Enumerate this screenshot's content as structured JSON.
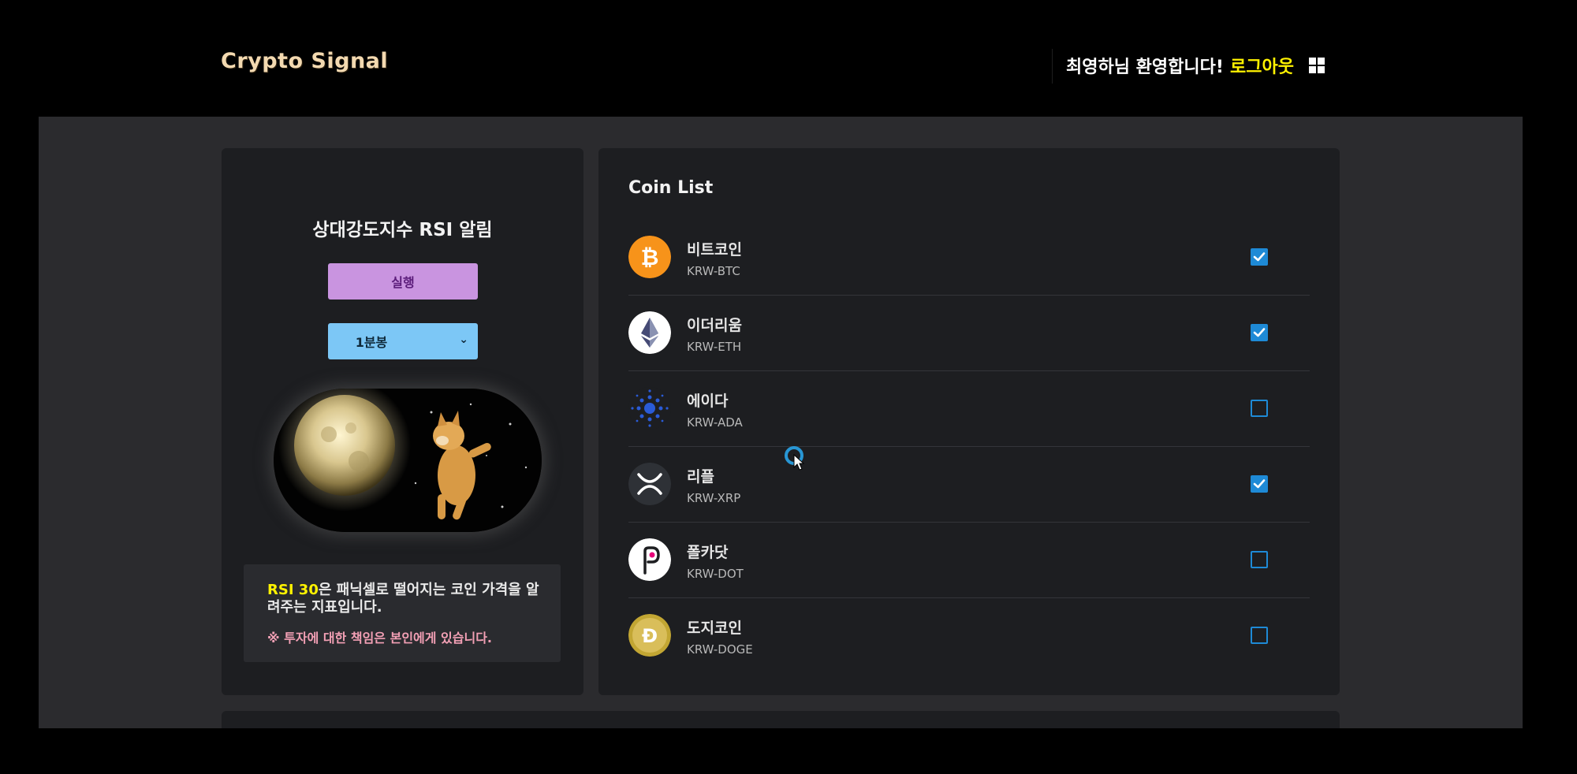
{
  "header": {
    "brand": "Crypto Signal",
    "welcome": "최영하님 환영합니다!",
    "logout": "로그아웃",
    "menu_icon": "grid-icon"
  },
  "left_panel": {
    "title": "상대강도지수 RSI 알림",
    "run_button": "실행",
    "interval_select": {
      "value": "1분봉"
    },
    "info": {
      "highlight": "RSI 30",
      "text": "은 패닉셀로 떨어지는 코인 가격을 알려주는 지표입니다.",
      "warning": "※ 투자에 대한 책임은 본인에게 있습니다."
    }
  },
  "coin_list": {
    "title": "Coin List",
    "items": [
      {
        "name": "비트코인",
        "code": "KRW-BTC",
        "checked": true,
        "icon": "bitcoin-icon"
      },
      {
        "name": "이더리움",
        "code": "KRW-ETH",
        "checked": true,
        "icon": "ethereum-icon"
      },
      {
        "name": "에이다",
        "code": "KRW-ADA",
        "checked": false,
        "icon": "cardano-icon"
      },
      {
        "name": "리플",
        "code": "KRW-XRP",
        "checked": true,
        "icon": "xrp-icon"
      },
      {
        "name": "폴카닷",
        "code": "KRW-DOT",
        "checked": false,
        "icon": "polkadot-icon"
      },
      {
        "name": "도지코인",
        "code": "KRW-DOGE",
        "checked": false,
        "icon": "dogecoin-icon"
      }
    ]
  },
  "colors": {
    "accent_yellow": "#fff200",
    "run_button": "#c994e0",
    "select_bg": "#7cc7f6",
    "checkbox": "#1e8ad6",
    "warning_pink": "#f3a0b5"
  }
}
